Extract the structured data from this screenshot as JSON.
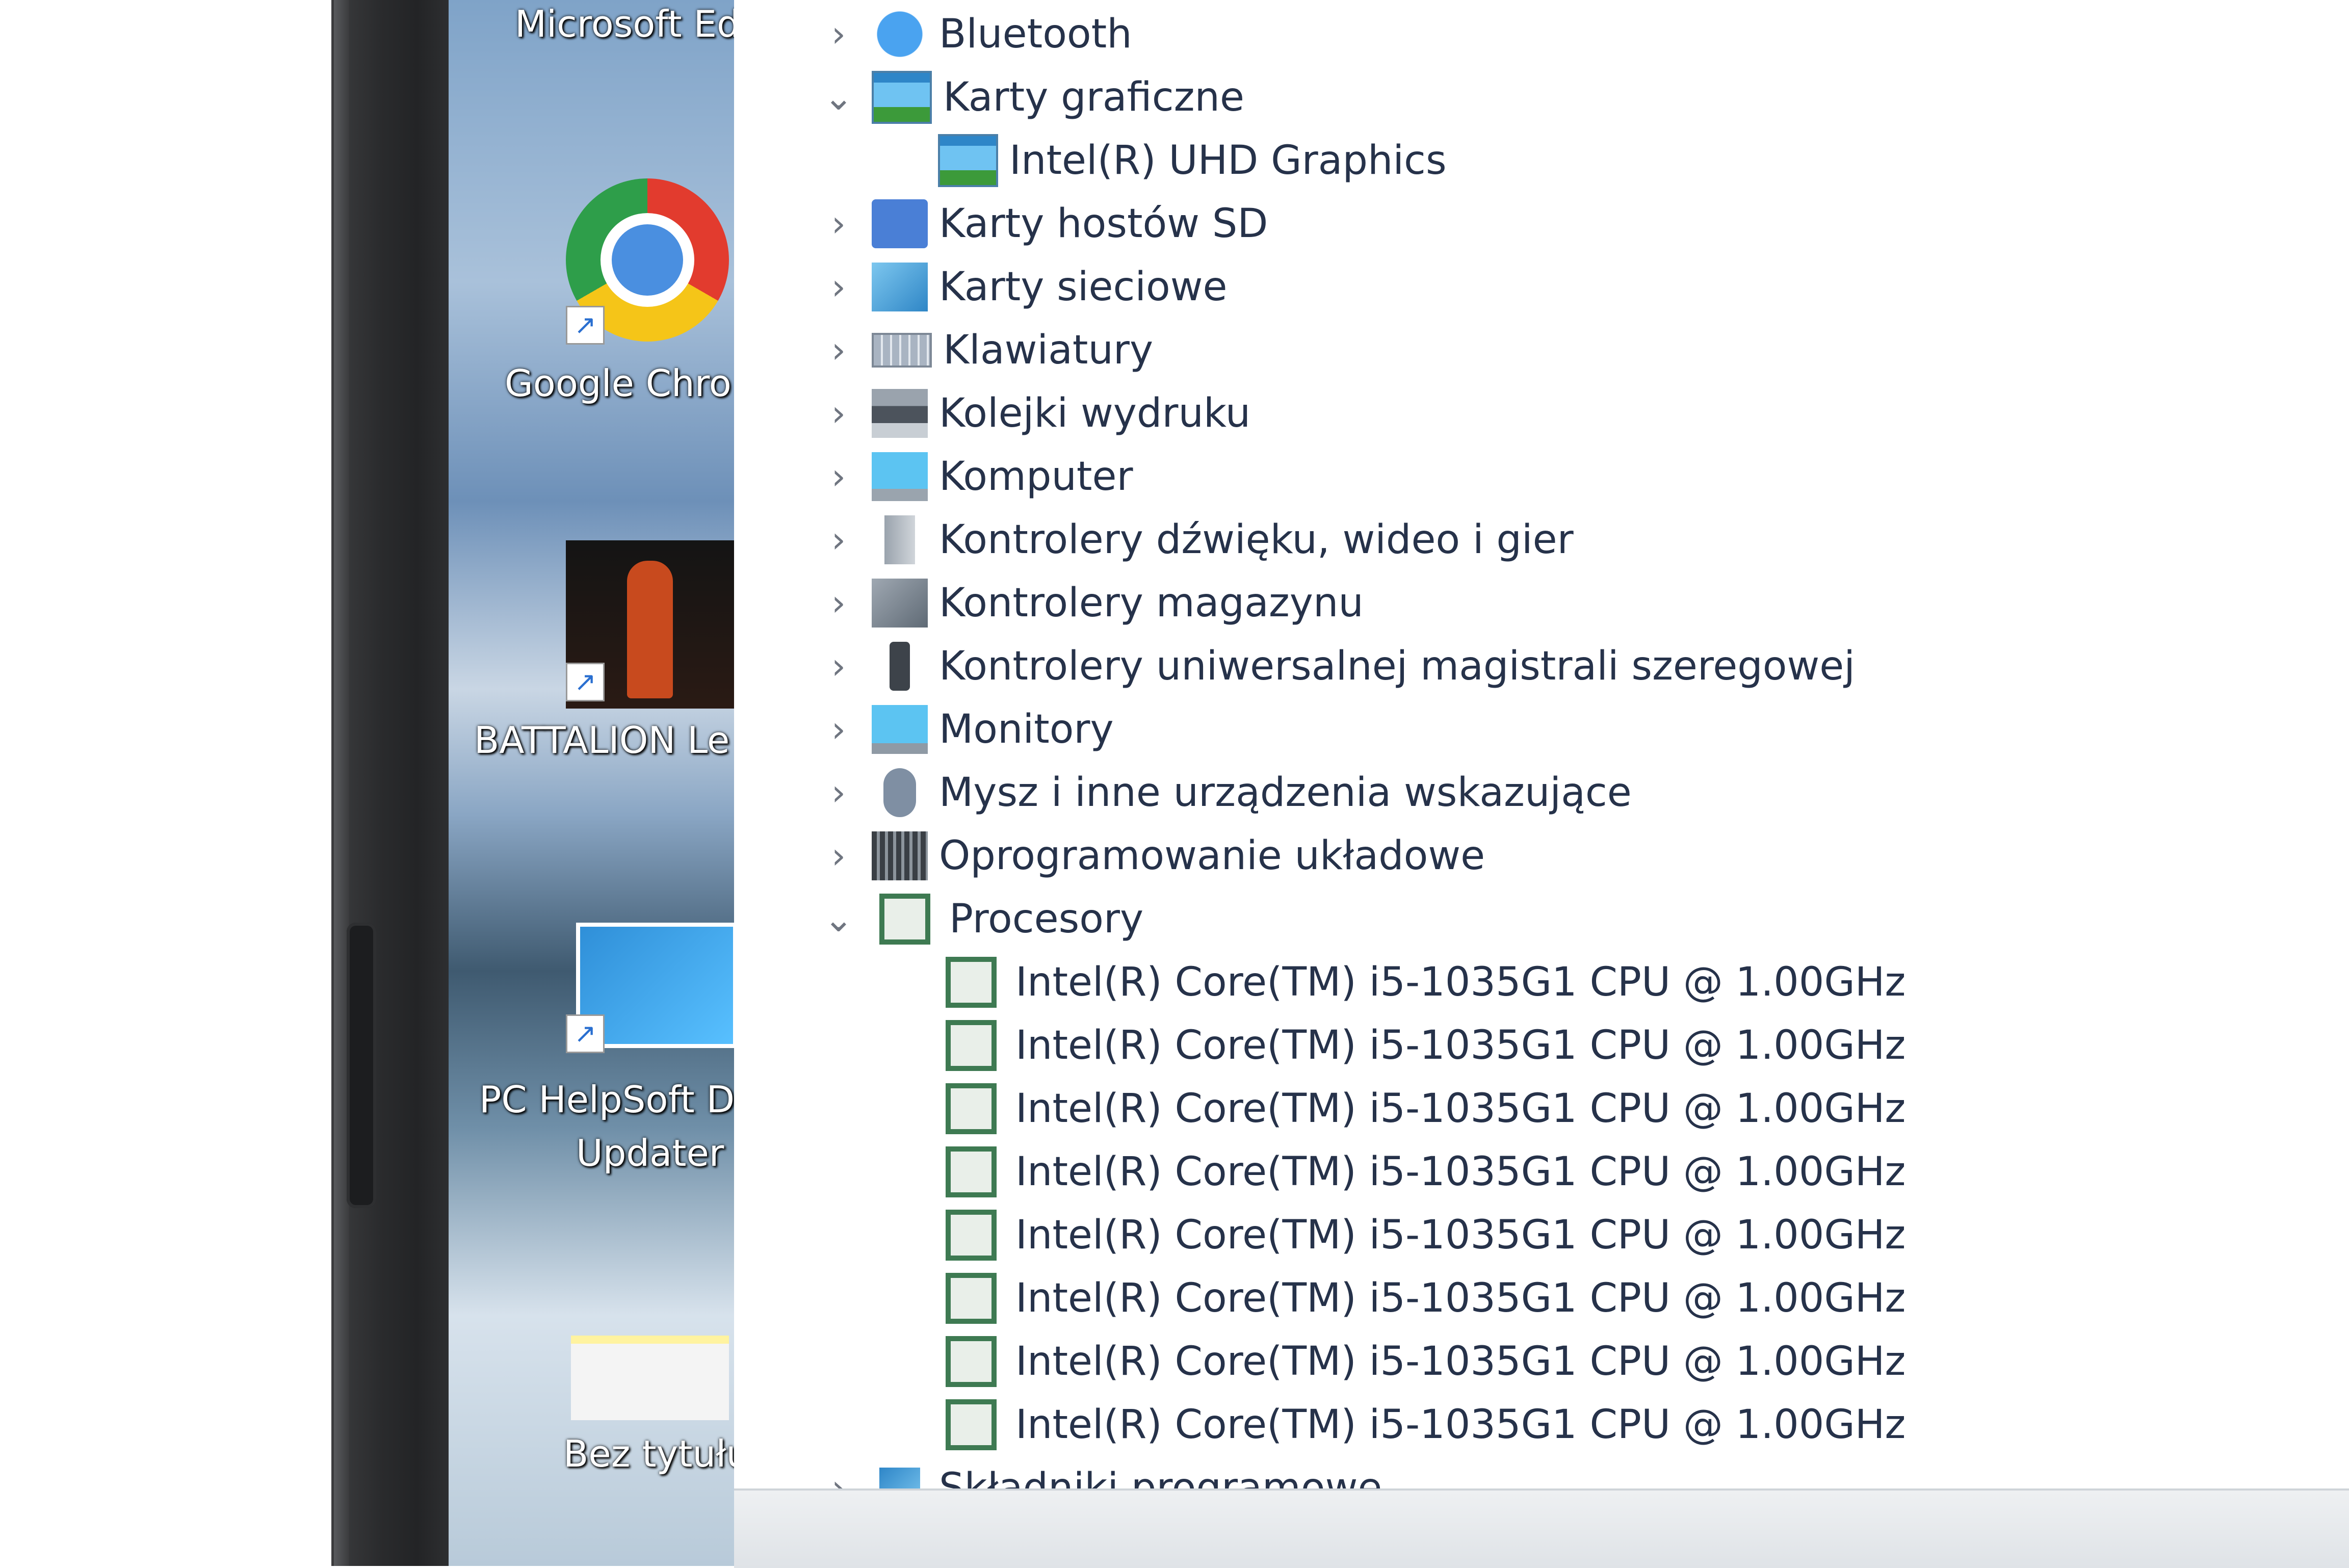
{
  "desktop": {
    "icons": [
      {
        "label": "Microsoft Ed",
        "icon": "edge-icon"
      },
      {
        "label": "Google Chro",
        "icon": "chrome-icon"
      },
      {
        "label": "BATTALION Le",
        "icon": "battalion-icon"
      },
      {
        "label": "PC HelpSoft D",
        "label2": "Updater",
        "icon": "helpsoft-icon"
      },
      {
        "label": "Bez tytułu",
        "icon": "document-icon"
      }
    ]
  },
  "device_manager": {
    "items": [
      {
        "label": "Bluetooth",
        "icon": "bluetooth-icon",
        "expanded": false
      },
      {
        "label": "Karty graficzne",
        "icon": "display-adapter-icon",
        "expanded": true
      },
      {
        "label": "Intel(R) UHD Graphics",
        "icon": "display-adapter-icon",
        "child": true
      },
      {
        "label": "Karty hostów SD",
        "icon": "sd-host-icon",
        "expanded": false
      },
      {
        "label": "Karty sieciowe",
        "icon": "network-adapter-icon",
        "expanded": false
      },
      {
        "label": "Klawiatury",
        "icon": "keyboard-icon",
        "expanded": false
      },
      {
        "label": "Kolejki wydruku",
        "icon": "printer-icon",
        "expanded": false
      },
      {
        "label": "Komputer",
        "icon": "computer-icon",
        "expanded": false
      },
      {
        "label": "Kontrolery dźwięku, wideo i gier",
        "icon": "speaker-icon",
        "expanded": false
      },
      {
        "label": "Kontrolery magazynu",
        "icon": "storage-controller-icon",
        "expanded": false
      },
      {
        "label": "Kontrolery uniwersalnej magistrali szeregowej",
        "icon": "usb-icon",
        "expanded": false
      },
      {
        "label": "Monitory",
        "icon": "monitor-icon",
        "expanded": false
      },
      {
        "label": "Mysz i inne urządzenia wskazujące",
        "icon": "mouse-icon",
        "expanded": false
      },
      {
        "label": "Oprogramowanie układowe",
        "icon": "firmware-icon",
        "expanded": false
      },
      {
        "label": "Procesory",
        "icon": "processor-icon",
        "expanded": true
      },
      {
        "label": "Intel(R) Core(TM) i5-1035G1 CPU @ 1.00GHz",
        "icon": "processor-icon",
        "child": true
      },
      {
        "label": "Intel(R) Core(TM) i5-1035G1 CPU @ 1.00GHz",
        "icon": "processor-icon",
        "child": true
      },
      {
        "label": "Intel(R) Core(TM) i5-1035G1 CPU @ 1.00GHz",
        "icon": "processor-icon",
        "child": true
      },
      {
        "label": "Intel(R) Core(TM) i5-1035G1 CPU @ 1.00GHz",
        "icon": "processor-icon",
        "child": true
      },
      {
        "label": "Intel(R) Core(TM) i5-1035G1 CPU @ 1.00GHz",
        "icon": "processor-icon",
        "child": true
      },
      {
        "label": "Intel(R) Core(TM) i5-1035G1 CPU @ 1.00GHz",
        "icon": "processor-icon",
        "child": true
      },
      {
        "label": "Intel(R) Core(TM) i5-1035G1 CPU @ 1.00GHz",
        "icon": "processor-icon",
        "child": true
      },
      {
        "label": "Intel(R) Core(TM) i5-1035G1 CPU @ 1.00GHz",
        "icon": "processor-icon",
        "child": true
      },
      {
        "label": "Składniki programowe",
        "icon": "software-component-icon",
        "expanded": false
      }
    ]
  },
  "glyphs": {
    "collapsed": "›",
    "expanded": "⌄"
  }
}
